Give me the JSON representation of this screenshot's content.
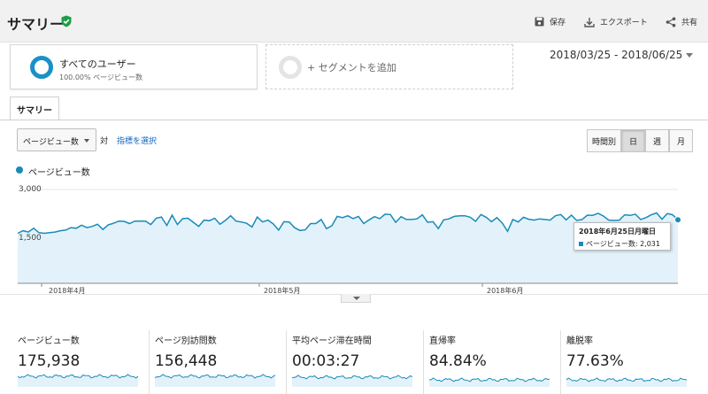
{
  "header": {
    "title": "サマリー",
    "save_label": "保存",
    "export_label": "エクスポート",
    "share_label": "共有"
  },
  "segments": [
    {
      "name": "すべてのユーザー",
      "sub": "100.00% ページビュー数"
    },
    {
      "name": "+ セグメントを追加"
    }
  ],
  "date_range": "2018/03/25 - 2018/06/25",
  "tab": "サマリー",
  "controls": {
    "metric": "ページビュー数",
    "vs": "対",
    "pick_metric": "指標を選択",
    "granularity": [
      "時間別",
      "日",
      "週",
      "月"
    ],
    "active_granularity": "日"
  },
  "tooltip": {
    "date": "2018年6月25日月曜日",
    "value": "ページビュー数: 2,031"
  },
  "metrics": [
    {
      "label": "ページビュー数",
      "value": "175,938"
    },
    {
      "label": "ページ別訪問数",
      "value": "156,448"
    },
    {
      "label": "平均ページ滞在時間",
      "value": "00:03:27"
    },
    {
      "label": "直帰率",
      "value": "84.84%"
    },
    {
      "label": "離脱率",
      "value": "77.63%"
    }
  ],
  "colors": {
    "accent": "#1a8bb8",
    "area": "#e3f2fa"
  },
  "chart_data": {
    "type": "area",
    "series": [
      {
        "name": "ページビュー数",
        "values": [
          1600,
          1680,
          1640,
          1760,
          1620,
          1600,
          1620,
          1640,
          1680,
          1700,
          1780,
          1760,
          1860,
          1780,
          1820,
          1890,
          1720,
          1870,
          1920,
          1990,
          1980,
          1910,
          1990,
          1990,
          1990,
          1880,
          2080,
          2120,
          1850,
          2180,
          1880,
          2070,
          2080,
          1950,
          1820,
          2020,
          2000,
          2080,
          1890,
          2010,
          2160,
          1990,
          1960,
          1920,
          1800,
          2120,
          1960,
          2020,
          1900,
          1700,
          1970,
          1960,
          1780,
          1690,
          1710,
          1910,
          1910,
          2040,
          1750,
          1840,
          2140,
          2100,
          2160,
          2070,
          2140,
          1910,
          2030,
          2130,
          2070,
          2210,
          2200,
          1950,
          2130,
          2040,
          2040,
          2060,
          2190,
          1950,
          1970,
          1750,
          2030,
          2060,
          2140,
          2160,
          2160,
          2110,
          1980,
          2200,
          2110,
          1970,
          2100,
          1930,
          1660,
          2040,
          1960,
          2110,
          2050,
          2020,
          2060,
          2040,
          2020,
          2160,
          2200,
          2030,
          2180,
          2010,
          2040,
          2180,
          2170,
          2240,
          2150,
          2020,
          2010,
          2020,
          2190,
          2170,
          2210,
          2040,
          2100,
          2190,
          2250,
          2050,
          2230,
          2190,
          2031
        ]
      }
    ],
    "x_labels": [
      "2018年4月",
      "2018年5月",
      "2018年6月"
    ],
    "y_ticks": [
      "3,000",
      "1,500"
    ],
    "ylim": [
      0,
      3000
    ]
  }
}
